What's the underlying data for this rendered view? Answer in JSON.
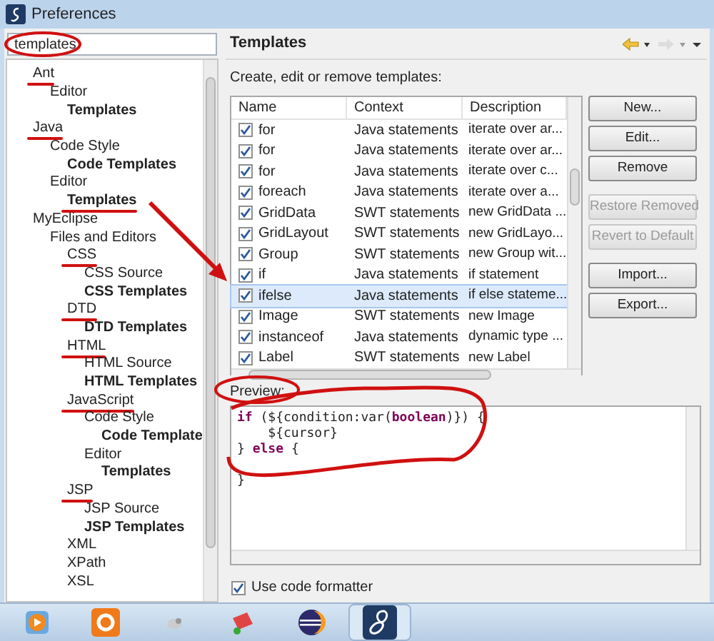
{
  "window": {
    "title": "Preferences"
  },
  "search": {
    "value": "templates"
  },
  "tree": [
    {
      "label": "Ant",
      "bold": false,
      "marked": true,
      "children": [
        {
          "label": "Editor",
          "bold": false,
          "marked": false,
          "children": [
            {
              "label": "Templates",
              "bold": true,
              "marked": false
            }
          ]
        }
      ]
    },
    {
      "label": "Java",
      "bold": false,
      "marked": true,
      "children": [
        {
          "label": "Code Style",
          "bold": false,
          "marked": false,
          "children": [
            {
              "label": "Code Templates",
              "bold": true,
              "marked": false
            }
          ]
        },
        {
          "label": "Editor",
          "bold": false,
          "marked": false,
          "children": [
            {
              "label": "Templates",
              "bold": true,
              "marked": true
            }
          ]
        }
      ]
    },
    {
      "label": "MyEclipse",
      "bold": false,
      "marked": false,
      "children": [
        {
          "label": "Files and Editors",
          "bold": false,
          "marked": false,
          "children": [
            {
              "label": "CSS",
              "bold": false,
              "marked": true,
              "children": [
                {
                  "label": "CSS Source",
                  "bold": false,
                  "marked": false
                },
                {
                  "label": "CSS Templates",
                  "bold": true,
                  "marked": false
                }
              ]
            },
            {
              "label": "DTD",
              "bold": false,
              "marked": true,
              "children": [
                {
                  "label": "DTD Templates",
                  "bold": true,
                  "marked": false
                }
              ]
            },
            {
              "label": "HTML",
              "bold": false,
              "marked": true,
              "children": [
                {
                  "label": "HTML Source",
                  "bold": false,
                  "marked": false
                },
                {
                  "label": "HTML Templates",
                  "bold": true,
                  "marked": false
                }
              ]
            },
            {
              "label": "JavaScript",
              "bold": false,
              "marked": true,
              "children": [
                {
                  "label": "Code Style",
                  "bold": false,
                  "marked": false,
                  "children": [
                    {
                      "label": "Code Template",
                      "bold": true,
                      "marked": false
                    }
                  ]
                },
                {
                  "label": "Editor",
                  "bold": false,
                  "marked": false,
                  "children": [
                    {
                      "label": "Templates",
                      "bold": true,
                      "marked": false
                    }
                  ]
                }
              ]
            },
            {
              "label": "JSP",
              "bold": false,
              "marked": true,
              "children": [
                {
                  "label": "JSP Source",
                  "bold": false,
                  "marked": false
                },
                {
                  "label": "JSP Templates",
                  "bold": true,
                  "marked": false
                }
              ]
            },
            {
              "label": "XML",
              "bold": false,
              "marked": false
            },
            {
              "label": "XPath",
              "bold": false,
              "marked": false
            },
            {
              "label": "XSL",
              "bold": false,
              "marked": false
            }
          ]
        }
      ]
    }
  ],
  "page": {
    "title": "Templates",
    "description": "Create, edit or remove templates:"
  },
  "table": {
    "columns": [
      "Name",
      "Context",
      "Description"
    ],
    "rows": [
      {
        "name": "for",
        "context": "Java statements",
        "description": "iterate over ar...",
        "checked": true,
        "selected": false
      },
      {
        "name": "for",
        "context": "Java statements",
        "description": "iterate over ar...",
        "checked": true,
        "selected": false
      },
      {
        "name": "for",
        "context": "Java statements",
        "description": "iterate over c...",
        "checked": true,
        "selected": false
      },
      {
        "name": "foreach",
        "context": "Java statements",
        "description": "iterate over a...",
        "checked": true,
        "selected": false
      },
      {
        "name": "GridData",
        "context": "SWT statements",
        "description": "new GridData ...",
        "checked": true,
        "selected": false
      },
      {
        "name": "GridLayout",
        "context": "SWT statements",
        "description": "new GridLayo...",
        "checked": true,
        "selected": false
      },
      {
        "name": "Group",
        "context": "SWT statements",
        "description": "new Group wit...",
        "checked": true,
        "selected": false
      },
      {
        "name": "if",
        "context": "Java statements",
        "description": "if statement",
        "checked": true,
        "selected": false
      },
      {
        "name": "ifelse",
        "context": "Java statements",
        "description": "if else stateme...",
        "checked": true,
        "selected": true
      },
      {
        "name": "Image",
        "context": "SWT statements",
        "description": "new Image",
        "checked": true,
        "selected": false
      },
      {
        "name": "instanceof",
        "context": "Java statements",
        "description": "dynamic type ...",
        "checked": true,
        "selected": false
      },
      {
        "name": "Label",
        "context": "SWT statements",
        "description": "new Label",
        "checked": true,
        "selected": false
      }
    ]
  },
  "button_groups": [
    [
      {
        "label": "New...",
        "disabled": false
      },
      {
        "label": "Edit...",
        "disabled": false
      },
      {
        "label": "Remove",
        "disabled": false
      }
    ],
    [
      {
        "label": "Restore Removed",
        "disabled": true
      },
      {
        "label": "Revert to Default",
        "disabled": true
      }
    ],
    [
      {
        "label": "Import...",
        "disabled": false
      },
      {
        "label": "Export...",
        "disabled": false
      }
    ]
  ],
  "preview": {
    "label": "Preview:",
    "lines": [
      [
        {
          "kind": "keyword",
          "text": "if"
        },
        {
          "kind": "plain",
          "text": " (${condition:var("
        },
        {
          "kind": "keyword",
          "text": "boolean"
        },
        {
          "kind": "plain",
          "text": ")}) {"
        }
      ],
      [
        {
          "kind": "plain",
          "text": "    ${cursor}"
        }
      ],
      [
        {
          "kind": "plain",
          "text": "} "
        },
        {
          "kind": "keyword",
          "text": "else"
        },
        {
          "kind": "plain",
          "text": " {"
        }
      ],
      [
        {
          "kind": "blank"
        },
        {
          "kind": "plain",
          "text": "}"
        }
      ]
    ]
  },
  "formatter": {
    "label": "Use code formatter",
    "checked": true
  },
  "taskbar": [
    {
      "kind": "player",
      "active": false
    },
    {
      "kind": "browser",
      "active": false
    },
    {
      "kind": "mouse",
      "active": false
    },
    {
      "kind": "installer",
      "active": false
    },
    {
      "kind": "eclipse",
      "active": false
    },
    {
      "kind": "myeclipse",
      "active": true
    }
  ]
}
